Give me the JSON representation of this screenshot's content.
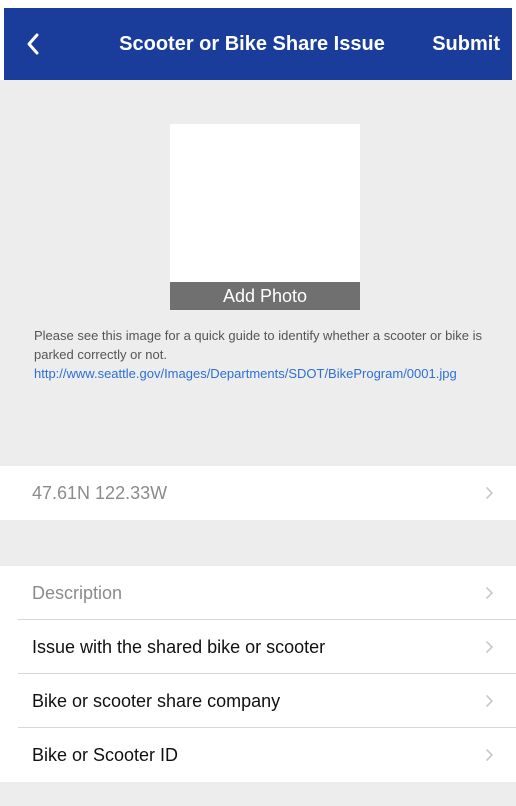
{
  "header": {
    "title": "Scooter or Bike Share Issue",
    "submit_label": "Submit",
    "back_icon": "chevron-left-icon"
  },
  "photo": {
    "button_label": "Add Photo",
    "guide_text": "Please see this image for a quick guide to identify whether a scooter or bike is parked correctly or not.",
    "guide_link": "http://www.seattle.gov/Images/Departments/SDOT/BikeProgram/0001.jpg"
  },
  "location": {
    "value": "47.61N 122.33W"
  },
  "fields": [
    {
      "label": "Description"
    },
    {
      "label": "Issue with the shared bike or scooter"
    },
    {
      "label": "Bike or scooter share company"
    },
    {
      "label": "Bike or Scooter ID"
    }
  ],
  "colors": {
    "header_bg": "#1a3d9c",
    "link": "#2f6fd6",
    "background": "#ededed"
  }
}
